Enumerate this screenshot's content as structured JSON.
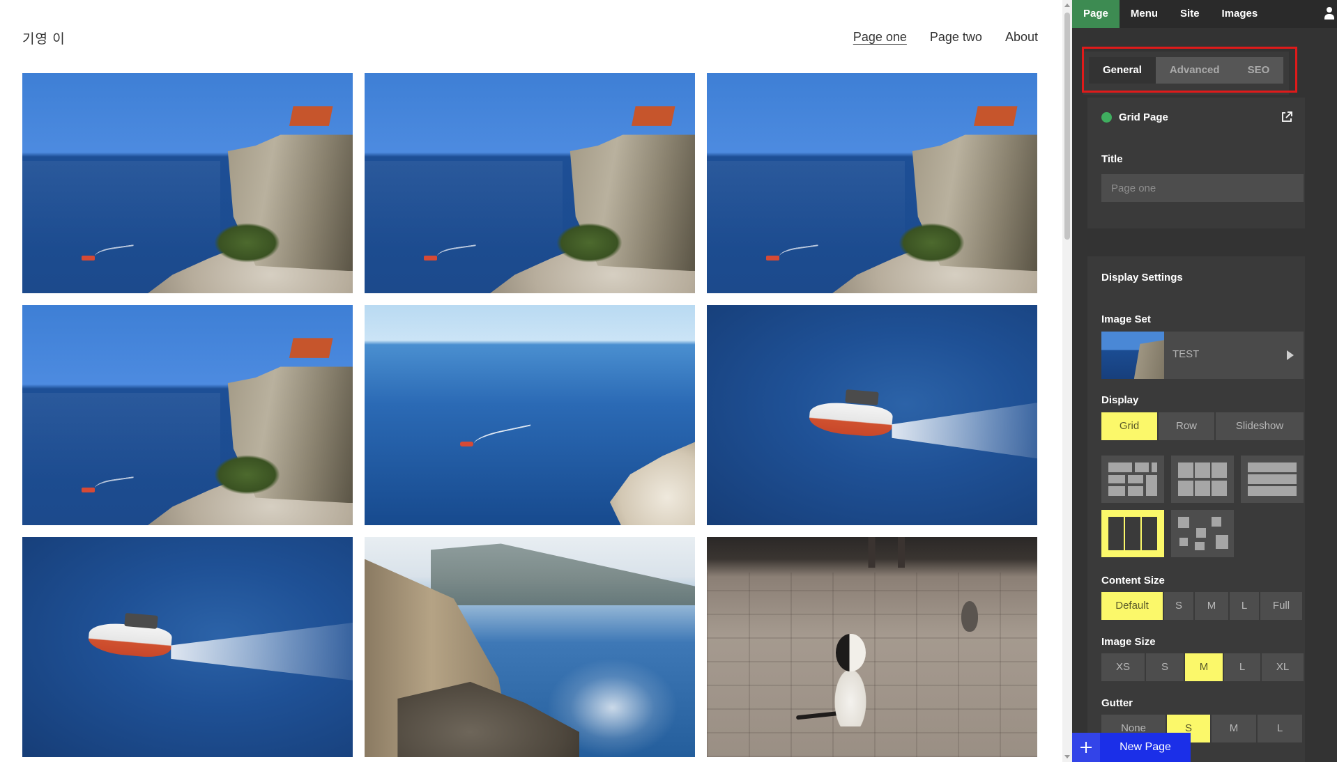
{
  "site": {
    "logo": "기영 이",
    "nav": [
      {
        "label": "Page one",
        "active": true
      },
      {
        "label": "Page two",
        "active": false
      },
      {
        "label": "About",
        "active": false
      }
    ],
    "photos": [
      "fortress",
      "fortress",
      "fortress",
      "fortress",
      "open-sea-boat",
      "speedboat",
      "speedboat",
      "coastline",
      "cat-and-pigeon"
    ]
  },
  "editor": {
    "topnav": [
      {
        "label": "Page",
        "active": true
      },
      {
        "label": "Menu",
        "active": false
      },
      {
        "label": "Site",
        "active": false
      },
      {
        "label": "Images",
        "active": false
      }
    ],
    "subtabs": [
      {
        "label": "General",
        "active": true
      },
      {
        "label": "Advanced",
        "active": false
      },
      {
        "label": "SEO",
        "active": false
      }
    ],
    "page_status": {
      "label": "Grid Page",
      "color": "#3fae5f"
    },
    "title_label": "Title",
    "title_placeholder": "Page one",
    "display_settings": {
      "heading": "Display Settings",
      "image_set": {
        "label": "Image Set",
        "name": "TEST"
      },
      "display": {
        "label": "Display",
        "options": [
          "Grid",
          "Row",
          "Slideshow"
        ],
        "selected": "Grid"
      },
      "layouts": [
        "mosaic",
        "grid",
        "rows",
        "columns",
        "scattered"
      ],
      "selected_layout": "columns",
      "content_size": {
        "label": "Content Size",
        "options": [
          "Default",
          "S",
          "M",
          "L",
          "Full"
        ],
        "selected": "Default"
      },
      "image_size": {
        "label": "Image Size",
        "options": [
          "XS",
          "S",
          "M",
          "L",
          "XL"
        ],
        "selected": "M"
      },
      "gutter": {
        "label": "Gutter",
        "options": [
          "None",
          "S",
          "M",
          "L"
        ],
        "selected": "S"
      }
    },
    "new_page_label": "New Page"
  },
  "colors": {
    "accent_green": "#3d8b52",
    "selected_yellow": "#fbf86a",
    "new_page_blue": "#1b2fe8",
    "highlight_red": "#e01a1a"
  }
}
